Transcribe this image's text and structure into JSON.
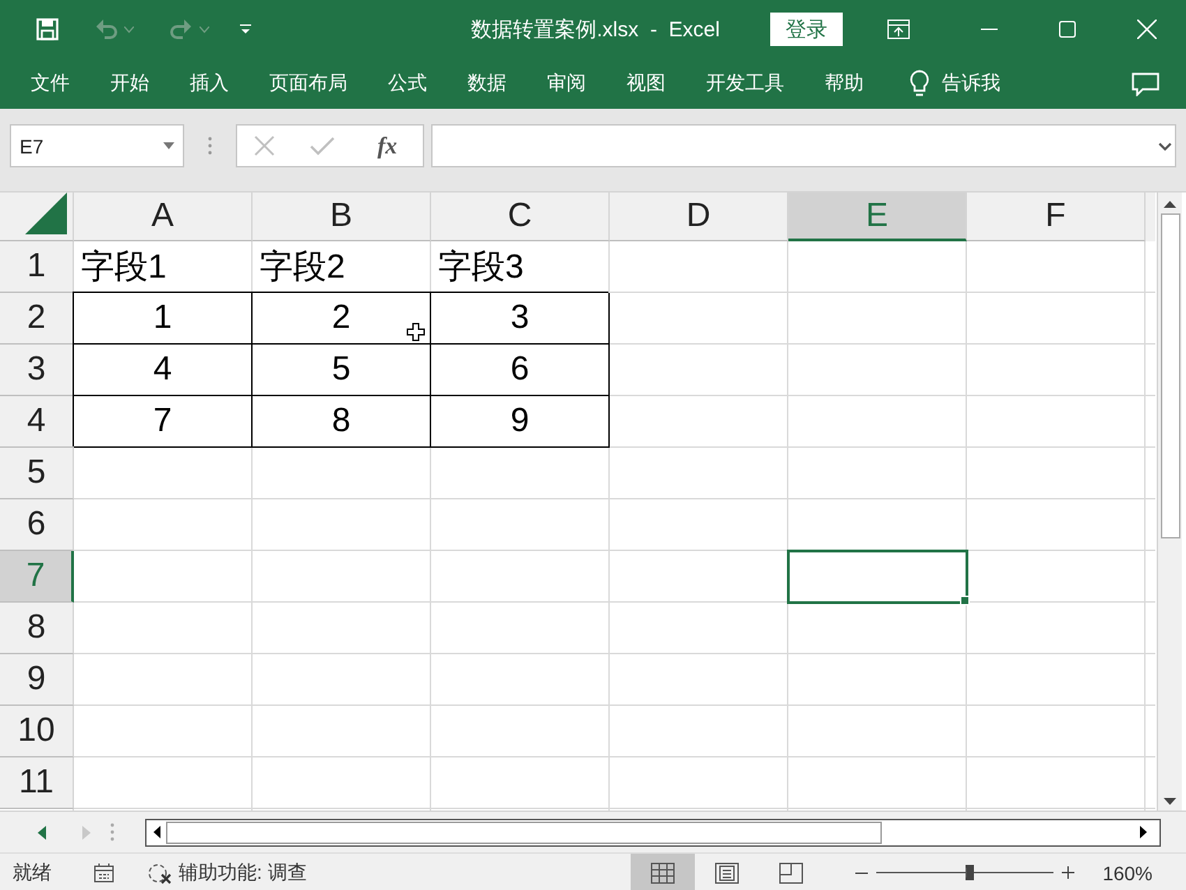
{
  "title_bar": {
    "quick_access": [
      {
        "kind": "save",
        "disabled": false
      },
      {
        "kind": "undo",
        "disabled": true
      },
      {
        "kind": "redo",
        "disabled": true
      }
    ],
    "title": "数据转置案例.xlsx  -  Excel",
    "login": "登录"
  },
  "ribbon": {
    "tabs": [
      {
        "label": "文件"
      },
      {
        "label": "开始"
      },
      {
        "label": "插入"
      },
      {
        "label": "页面布局"
      },
      {
        "label": "公式"
      },
      {
        "label": "数据"
      },
      {
        "label": "审阅"
      },
      {
        "label": "视图"
      },
      {
        "label": "开发工具"
      },
      {
        "label": "帮助"
      }
    ],
    "tell_me": "告诉我"
  },
  "formula_bar": {
    "name_box": "E7",
    "fx": "fx"
  },
  "sheet": {
    "columns": [
      {
        "label": "A",
        "selected": false
      },
      {
        "label": "B",
        "selected": false
      },
      {
        "label": "C",
        "selected": false
      },
      {
        "label": "D",
        "selected": false
      },
      {
        "label": "E",
        "selected": true
      },
      {
        "label": "F",
        "selected": false
      }
    ],
    "rows": [
      {
        "label": "1",
        "selected": false,
        "kind": "header",
        "cells": [
          "字段1",
          "字段2",
          "字段3"
        ]
      },
      {
        "label": "2",
        "selected": false,
        "kind": "data",
        "cells": [
          "1",
          "2",
          "3"
        ]
      },
      {
        "label": "3",
        "selected": false,
        "kind": "data",
        "cells": [
          "4",
          "5",
          "6"
        ]
      },
      {
        "label": "4",
        "selected": false,
        "kind": "data",
        "cells": [
          "7",
          "8",
          "9"
        ]
      },
      {
        "label": "5",
        "selected": false
      },
      {
        "label": "6",
        "selected": false
      },
      {
        "label": "7",
        "selected": true
      },
      {
        "label": "8",
        "selected": false
      },
      {
        "label": "9",
        "selected": false
      },
      {
        "label": "10",
        "selected": false
      },
      {
        "label": "11",
        "selected": false
      }
    ]
  },
  "status_bar": {
    "ready": "就绪",
    "accessibility": "辅助功能: 调查",
    "views": [
      {
        "kind": "normal",
        "selected": true
      },
      {
        "kind": "page_layout",
        "selected": false
      },
      {
        "kind": "page_break",
        "selected": false
      }
    ],
    "zoom": {
      "level": 0.53,
      "reading": "160%"
    }
  }
}
